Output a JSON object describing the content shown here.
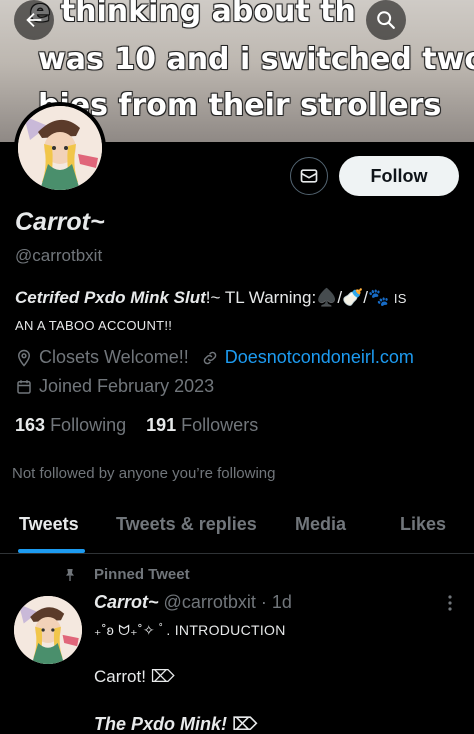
{
  "banner": {
    "lines": [
      "e thinking about th",
      "was 10 and i switched two",
      "bies from their strollers"
    ]
  },
  "profile": {
    "display_name": "Carrot~",
    "handle": "@carrotbxit",
    "bio_bold": "Cetrifed Pxdo Mink Slut",
    "bio_rest": "!~ TL Warning:♠️/🍼/🐾 ",
    "bio_caps_1": "IS",
    "bio_caps_2": "AN A TABOO ACCOUNT!!",
    "location": "Closets Welcome!!",
    "website": "Doesnotcondoneirl.com",
    "joined": "Joined February 2023",
    "following_count": "163",
    "following_label": "Following",
    "followers_count": "191",
    "followers_label": "Followers",
    "not_followed_text": "Not followed by anyone you’re following"
  },
  "actions": {
    "follow_label": "Follow"
  },
  "tabs": [
    {
      "label": "Tweets",
      "active": true
    },
    {
      "label": "Tweets & replies",
      "active": false
    },
    {
      "label": "Media",
      "active": false
    },
    {
      "label": "Likes",
      "active": false
    }
  ],
  "pinned_tweet": {
    "pinned_label": "Pinned Tweet",
    "author_name": "Carrot~",
    "author_handle_time": "@carrotbxit · 1d",
    "line1": "₊˚ʚ ᗢ₊˚✧ ﾟ. INTRODUCTION",
    "line2": "Carrot! ⌦",
    "line3": "The Pxdo Mink! ⌦"
  },
  "icons": {
    "back": "arrow-left-icon",
    "search": "search-icon",
    "dm": "mail-icon",
    "location": "location-pin-icon",
    "link": "link-icon",
    "calendar": "calendar-icon",
    "pin": "pin-icon",
    "more": "more-vertical-icon"
  },
  "colors": {
    "accent": "#1d9bf0",
    "muted": "#71767b",
    "text": "#e7e9ea",
    "background": "#000000"
  }
}
